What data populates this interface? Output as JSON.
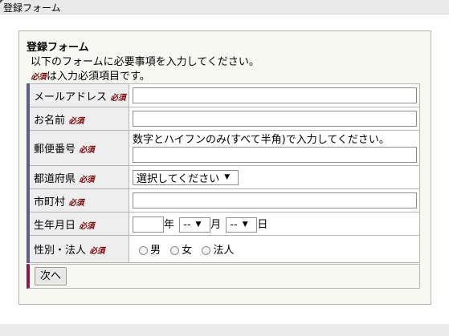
{
  "window": {
    "title": "登録フォーム"
  },
  "form": {
    "heading": "登録フォーム",
    "description": "以下のフォームに必要事項を入力してください。",
    "required_note_suffix": "は入力必須項目です。",
    "required_mark": "必須",
    "fields": {
      "email": {
        "label": "メールアドレス",
        "value": ""
      },
      "name": {
        "label": "お名前",
        "value": ""
      },
      "postal": {
        "label": "郵便番号",
        "hint": "数字とハイフンのみ(すべて半角)で入力してください。",
        "value": ""
      },
      "prefecture": {
        "label": "都道府県",
        "selected": "選択してください"
      },
      "city": {
        "label": "市町村",
        "value": ""
      },
      "birthdate": {
        "label": "生年月日",
        "year_value": "",
        "year_unit": "年",
        "month_selected": "--",
        "month_unit": "月",
        "day_selected": "--",
        "day_unit": "日"
      },
      "gender": {
        "label": "性別・法人",
        "options": [
          "男",
          "女",
          "法人"
        ]
      }
    },
    "next_button": "次へ"
  },
  "colors": {
    "required": "#7a0a0a",
    "label_accent": "#5a5aa0",
    "button_row_accent": "#8a1a4a"
  }
}
